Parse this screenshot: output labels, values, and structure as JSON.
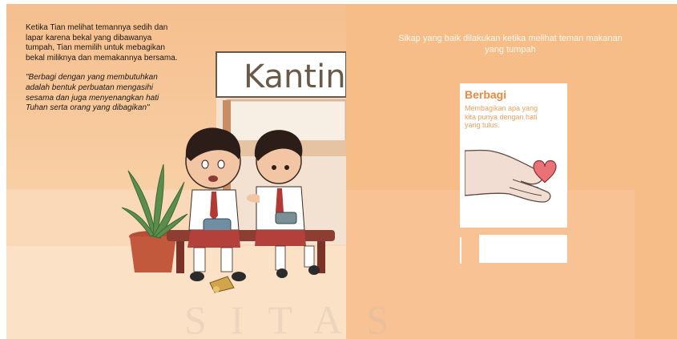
{
  "story": {
    "narration": "Ketika Tian melihat temannya sedih dan lapar karena bekal yang dibawanya tumpah, Tian memilih untuk mebagikan bekal miliknya dan memakannya bersama.",
    "quote": "\"Berbagi dengan yang membutuhkan adalah bentuk perbuatan mengasihi sesama dan juga menyenangkan hati Tuhan serta orang yang dibagikan\""
  },
  "scene": {
    "sign_text": "Kantin"
  },
  "activity": {
    "heading": "Sikap yang baik dilakukan ketika melihat teman makanan yang tumpah",
    "card": {
      "title": "Berbagi",
      "description": "Membagikan apa yang kita punya dengan hati yang tulus."
    }
  },
  "watermark": "SITAS",
  "colors": {
    "right_background": "#f7bd88",
    "card_title": "#e98a3f",
    "card_text": "#eba05e"
  }
}
